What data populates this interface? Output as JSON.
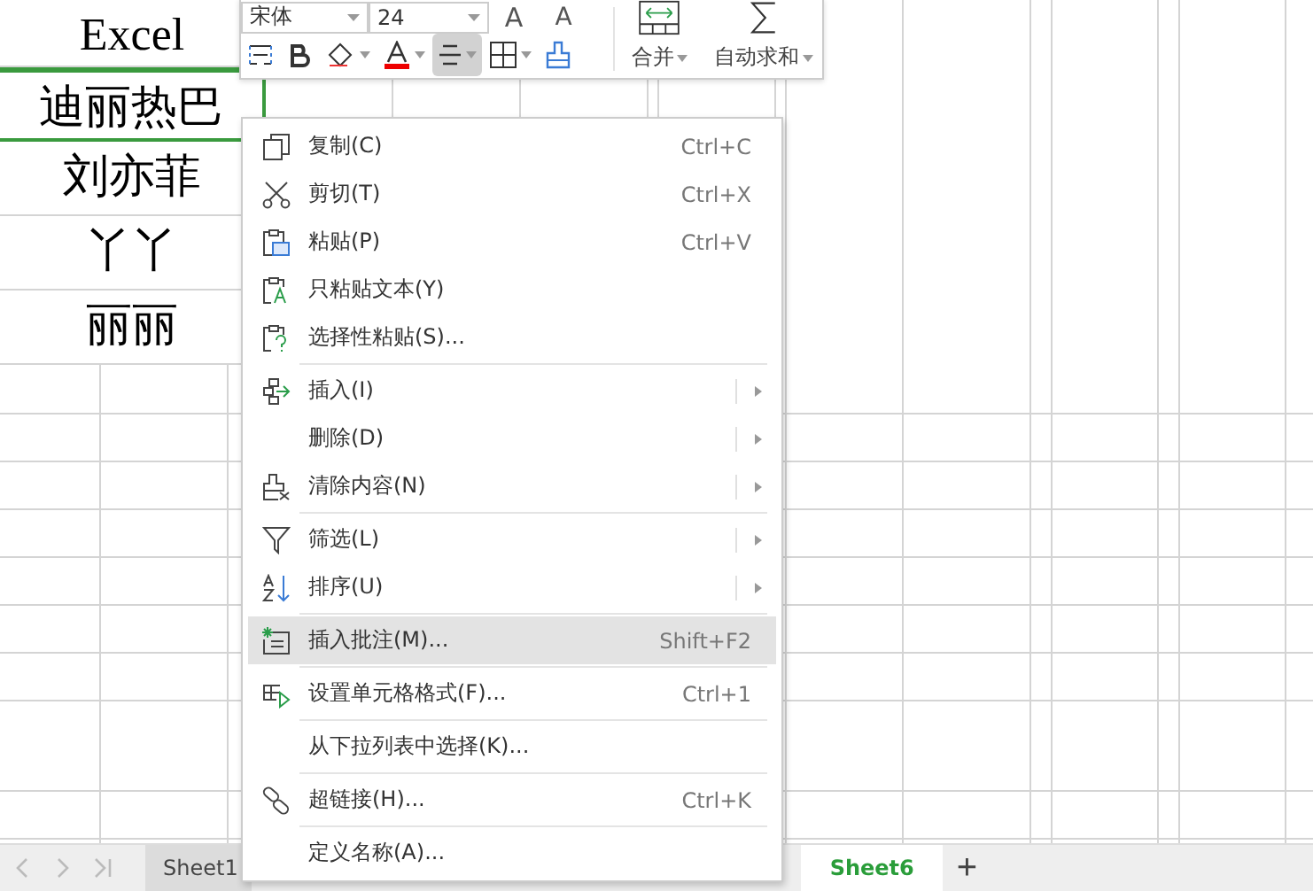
{
  "cells": [
    {
      "text": "Excel",
      "selected": false
    },
    {
      "text": "迪丽热巴",
      "selected": true
    },
    {
      "text": "刘亦菲",
      "selected": false
    },
    {
      "text": "丫丫",
      "selected": false
    },
    {
      "text": "丽丽",
      "selected": false
    }
  ],
  "toolbar": {
    "font_name": "宋体",
    "font_size": "24",
    "grow_font": "A",
    "shrink_font": "A",
    "merge": "合并",
    "autosum": "自动求和",
    "tools": [
      {
        "kind": "wrap",
        "selected": false
      },
      {
        "kind": "bold",
        "selected": false
      },
      {
        "kind": "fill",
        "selected": false
      },
      {
        "kind": "color",
        "selected": false
      },
      {
        "kind": "align",
        "selected": true
      },
      {
        "kind": "border",
        "selected": false
      },
      {
        "kind": "brush",
        "selected": false
      }
    ]
  },
  "context_menu": {
    "sections": [
      [
        {
          "kind": "copy",
          "label": "复制(C)",
          "shortcut": "Ctrl+C",
          "submenu": false,
          "selected": false
        },
        {
          "kind": "cut",
          "label": "剪切(T)",
          "shortcut": "Ctrl+X",
          "submenu": false,
          "selected": false
        },
        {
          "kind": "paste",
          "label": "粘贴(P)",
          "shortcut": "Ctrl+V",
          "submenu": false,
          "selected": false
        },
        {
          "kind": "paste-text",
          "label": "只粘贴文本(Y)",
          "submenu": false,
          "selected": false
        },
        {
          "kind": "paste-special",
          "label": "选择性粘贴(S)...",
          "submenu": false,
          "selected": false
        }
      ],
      [
        {
          "kind": "insert",
          "label": "插入(I)",
          "submenu": true,
          "selected": false
        },
        {
          "kind": "none",
          "label": "删除(D)",
          "submenu": true,
          "selected": false
        },
        {
          "kind": "clear",
          "label": "清除内容(N)",
          "submenu": true,
          "selected": false
        }
      ],
      [
        {
          "kind": "filter",
          "label": "筛选(L)",
          "submenu": true,
          "selected": false
        },
        {
          "kind": "sort",
          "label": "排序(U)",
          "submenu": true,
          "selected": false
        }
      ],
      [
        {
          "kind": "comment",
          "label": "插入批注(M)...",
          "shortcut": "Shift+F2",
          "submenu": false,
          "selected": true
        }
      ],
      [
        {
          "kind": "format",
          "label": "设置单元格格式(F)...",
          "shortcut": "Ctrl+1",
          "submenu": false,
          "selected": false
        }
      ],
      [
        {
          "kind": "none",
          "label": "从下拉列表中选择(K)...",
          "submenu": false,
          "selected": false
        }
      ],
      [
        {
          "kind": "link",
          "label": "超链接(H)...",
          "shortcut": "Ctrl+K",
          "submenu": false,
          "selected": false
        }
      ],
      [
        {
          "kind": "none",
          "label": "定义名称(A)...",
          "submenu": false,
          "selected": false
        }
      ]
    ]
  },
  "sheet_tabs": [
    {
      "label": "Sheet1",
      "selected": false
    },
    {
      "label": "Sheet6",
      "selected": true
    }
  ],
  "add_sheet": "+"
}
